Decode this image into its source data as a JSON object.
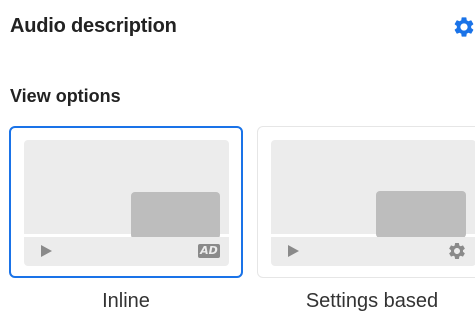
{
  "panel": {
    "title": "Audio description",
    "settings_icon": "gear-icon"
  },
  "view_options": {
    "heading": "View options",
    "options": [
      {
        "label": "Inline",
        "selected": true,
        "control_icons": [
          "play-icon",
          "audio-description-icon"
        ],
        "badge_text": "AD"
      },
      {
        "label": "Settings based",
        "selected": false,
        "control_icons": [
          "play-icon",
          "gear-icon"
        ]
      }
    ]
  },
  "colors": {
    "accent": "#1a73e8",
    "thumb_bg": "#ececec",
    "overlay": "#bdbdbd",
    "icon": "#8a8a8a"
  }
}
